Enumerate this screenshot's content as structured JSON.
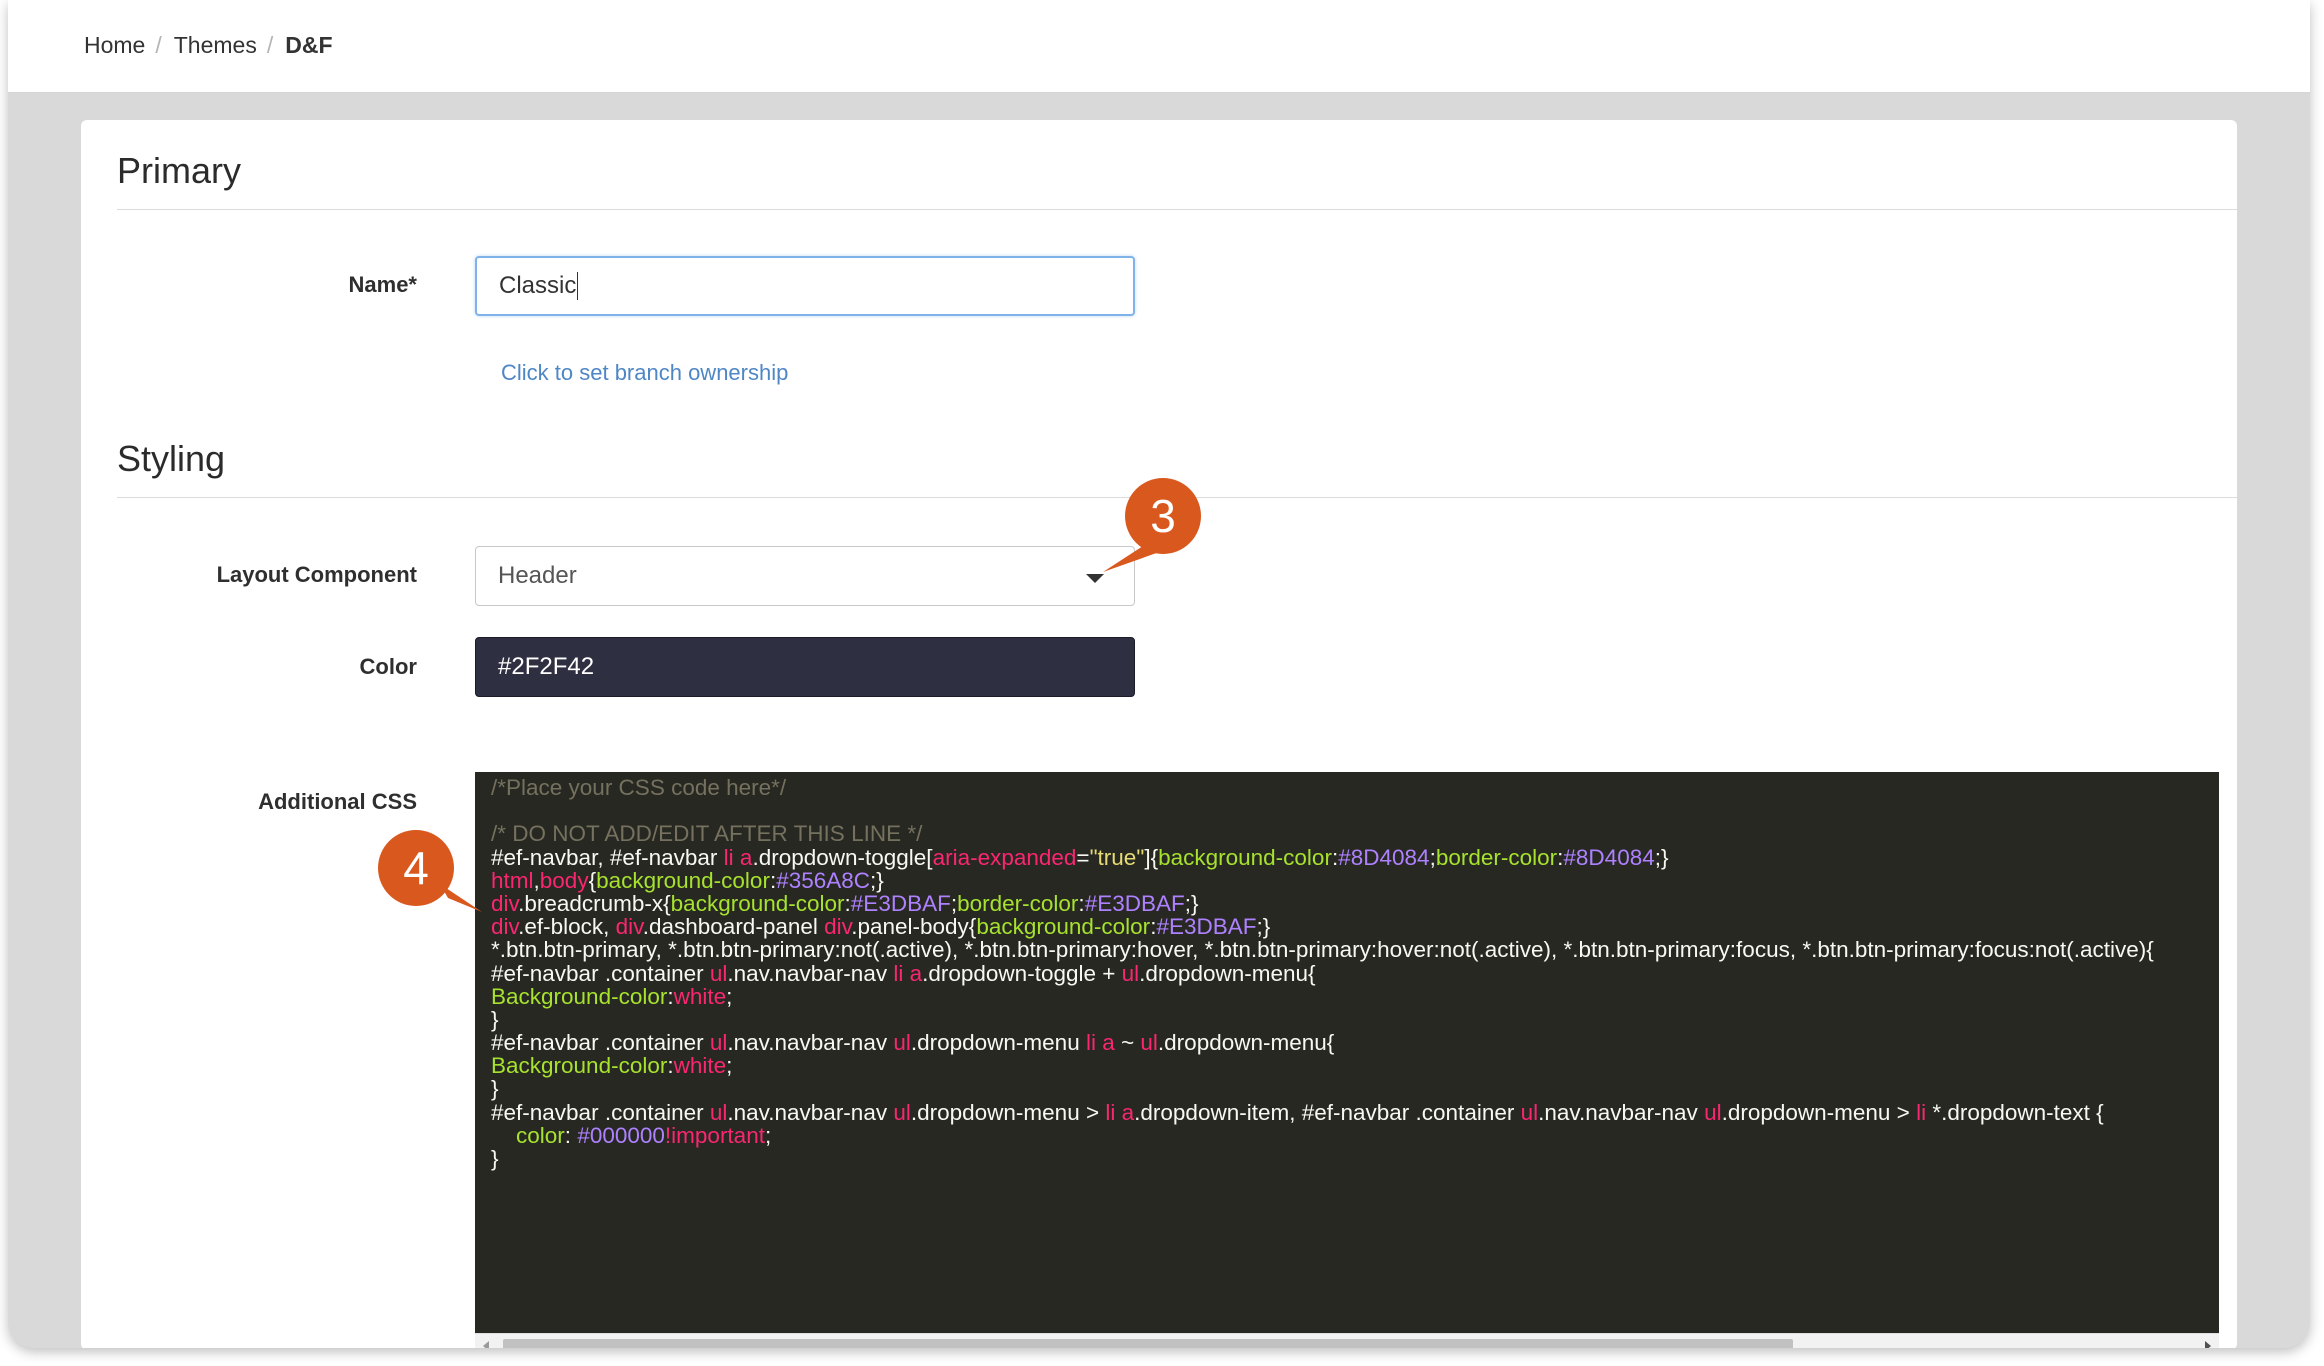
{
  "breadcrumb": {
    "items": [
      "Home",
      "Themes"
    ],
    "separator": "/",
    "current": "D&F"
  },
  "primary": {
    "title": "Primary",
    "name_label": "Name*",
    "name_value": "Classic",
    "branch_link": "Click to set branch ownership"
  },
  "styling": {
    "title": "Styling",
    "layout_label": "Layout Component",
    "layout_value": "Header",
    "color_label": "Color",
    "color_value": "#2F2F42",
    "css_label": "Additional CSS"
  },
  "code_lines": [
    [
      {
        "t": "/*Place your CSS code here*/",
        "c": "#75715e"
      }
    ],
    [],
    [
      {
        "t": "/* DO NOT ADD/EDIT AFTER THIS LINE */",
        "c": "#75715e"
      }
    ],
    [
      {
        "t": "#ef-navbar, #ef-navbar ",
        "c": "#f8f8f2"
      },
      {
        "t": "li",
        "c": "#f92672"
      },
      {
        "t": " ",
        "c": "#f8f8f2"
      },
      {
        "t": "a",
        "c": "#f92672"
      },
      {
        "t": ".dropdown-toggle[",
        "c": "#f8f8f2"
      },
      {
        "t": "aria-expanded",
        "c": "#f92672"
      },
      {
        "t": "=",
        "c": "#f8f8f2"
      },
      {
        "t": "\"true\"",
        "c": "#e6db74"
      },
      {
        "t": "]{",
        "c": "#f8f8f2"
      },
      {
        "t": "background-color",
        "c": "#a6e22e"
      },
      {
        "t": ":",
        "c": "#f8f8f2"
      },
      {
        "t": "#8D4084",
        "c": "#ae81ff"
      },
      {
        "t": ";",
        "c": "#f8f8f2"
      },
      {
        "t": "border-color",
        "c": "#a6e22e"
      },
      {
        "t": ":",
        "c": "#f8f8f2"
      },
      {
        "t": "#8D4084",
        "c": "#ae81ff"
      },
      {
        "t": ";}",
        "c": "#f8f8f2"
      }
    ],
    [
      {
        "t": "html",
        "c": "#f92672"
      },
      {
        "t": ",",
        "c": "#f8f8f2"
      },
      {
        "t": "body",
        "c": "#f92672"
      },
      {
        "t": "{",
        "c": "#f8f8f2"
      },
      {
        "t": "background-color",
        "c": "#a6e22e"
      },
      {
        "t": ":",
        "c": "#f8f8f2"
      },
      {
        "t": "#356A8C",
        "c": "#ae81ff"
      },
      {
        "t": ";}",
        "c": "#f8f8f2"
      }
    ],
    [
      {
        "t": "div",
        "c": "#f92672"
      },
      {
        "t": ".breadcrumb-x{",
        "c": "#f8f8f2"
      },
      {
        "t": "background-color",
        "c": "#a6e22e"
      },
      {
        "t": ":",
        "c": "#f8f8f2"
      },
      {
        "t": "#E3DBAF",
        "c": "#ae81ff"
      },
      {
        "t": ";",
        "c": "#f8f8f2"
      },
      {
        "t": "border-color",
        "c": "#a6e22e"
      },
      {
        "t": ":",
        "c": "#f8f8f2"
      },
      {
        "t": "#E3DBAF",
        "c": "#ae81ff"
      },
      {
        "t": ";}",
        "c": "#f8f8f2"
      }
    ],
    [
      {
        "t": "div",
        "c": "#f92672"
      },
      {
        "t": ".ef-block, ",
        "c": "#f8f8f2"
      },
      {
        "t": "div",
        "c": "#f92672"
      },
      {
        "t": ".dashboard-panel ",
        "c": "#f8f8f2"
      },
      {
        "t": "div",
        "c": "#f92672"
      },
      {
        "t": ".panel-body{",
        "c": "#f8f8f2"
      },
      {
        "t": "background-color",
        "c": "#a6e22e"
      },
      {
        "t": ":",
        "c": "#f8f8f2"
      },
      {
        "t": "#E3DBAF",
        "c": "#ae81ff"
      },
      {
        "t": ";}",
        "c": "#f8f8f2"
      }
    ],
    [
      {
        "t": "*.btn.btn-primary, *.btn.btn-primary:not(.active), *.btn.btn-primary:hover, *.btn.btn-primary:hover:not(.active), *.btn.btn-primary:focus, *.btn.btn-primary:focus:not(.active){",
        "c": "#f8f8f2"
      }
    ],
    [
      {
        "t": "#ef-navbar .container ",
        "c": "#f8f8f2"
      },
      {
        "t": "ul",
        "c": "#f92672"
      },
      {
        "t": ".nav.navbar-nav ",
        "c": "#f8f8f2"
      },
      {
        "t": "li",
        "c": "#f92672"
      },
      {
        "t": " ",
        "c": "#f8f8f2"
      },
      {
        "t": "a",
        "c": "#f92672"
      },
      {
        "t": ".dropdown-toggle + ",
        "c": "#f8f8f2"
      },
      {
        "t": "ul",
        "c": "#f92672"
      },
      {
        "t": ".dropdown-menu{",
        "c": "#f8f8f2"
      }
    ],
    [
      {
        "t": "Background-color",
        "c": "#a6e22e"
      },
      {
        "t": ":",
        "c": "#f8f8f2"
      },
      {
        "t": "white",
        "c": "#f92672"
      },
      {
        "t": ";",
        "c": "#f8f8f2"
      }
    ],
    [
      {
        "t": "}",
        "c": "#f8f8f2"
      }
    ],
    [
      {
        "t": "#ef-navbar .container ",
        "c": "#f8f8f2"
      },
      {
        "t": "ul",
        "c": "#f92672"
      },
      {
        "t": ".nav.navbar-nav ",
        "c": "#f8f8f2"
      },
      {
        "t": "ul",
        "c": "#f92672"
      },
      {
        "t": ".dropdown-menu ",
        "c": "#f8f8f2"
      },
      {
        "t": "li",
        "c": "#f92672"
      },
      {
        "t": " ",
        "c": "#f8f8f2"
      },
      {
        "t": "a",
        "c": "#f92672"
      },
      {
        "t": " ~ ",
        "c": "#f8f8f2"
      },
      {
        "t": "ul",
        "c": "#f92672"
      },
      {
        "t": ".dropdown-menu{",
        "c": "#f8f8f2"
      }
    ],
    [
      {
        "t": "Background-color",
        "c": "#a6e22e"
      },
      {
        "t": ":",
        "c": "#f8f8f2"
      },
      {
        "t": "white",
        "c": "#f92672"
      },
      {
        "t": ";",
        "c": "#f8f8f2"
      }
    ],
    [
      {
        "t": "}",
        "c": "#f8f8f2"
      }
    ],
    [
      {
        "t": "#ef-navbar .container ",
        "c": "#f8f8f2"
      },
      {
        "t": "ul",
        "c": "#f92672"
      },
      {
        "t": ".nav.navbar-nav ",
        "c": "#f8f8f2"
      },
      {
        "t": "ul",
        "c": "#f92672"
      },
      {
        "t": ".dropdown-menu > ",
        "c": "#f8f8f2"
      },
      {
        "t": "li",
        "c": "#f92672"
      },
      {
        "t": " ",
        "c": "#f8f8f2"
      },
      {
        "t": "a",
        "c": "#f92672"
      },
      {
        "t": ".dropdown-item, #ef-navbar .container ",
        "c": "#f8f8f2"
      },
      {
        "t": "ul",
        "c": "#f92672"
      },
      {
        "t": ".nav.navbar-nav ",
        "c": "#f8f8f2"
      },
      {
        "t": "ul",
        "c": "#f92672"
      },
      {
        "t": ".dropdown-menu > ",
        "c": "#f8f8f2"
      },
      {
        "t": "li",
        "c": "#f92672"
      },
      {
        "t": " *.dropdown-text {",
        "c": "#f8f8f2"
      }
    ],
    [
      {
        "t": "    ",
        "c": "#f8f8f2"
      },
      {
        "t": "color",
        "c": "#a6e22e"
      },
      {
        "t": ": ",
        "c": "#f8f8f2"
      },
      {
        "t": "#000000",
        "c": "#ae81ff"
      },
      {
        "t": "!important",
        "c": "#f92672"
      },
      {
        "t": ";",
        "c": "#f8f8f2"
      }
    ],
    [
      {
        "t": "}",
        "c": "#f8f8f2"
      }
    ]
  ],
  "markers": {
    "layout_marker": "3",
    "css_marker": "4",
    "color": "#d9581e"
  }
}
